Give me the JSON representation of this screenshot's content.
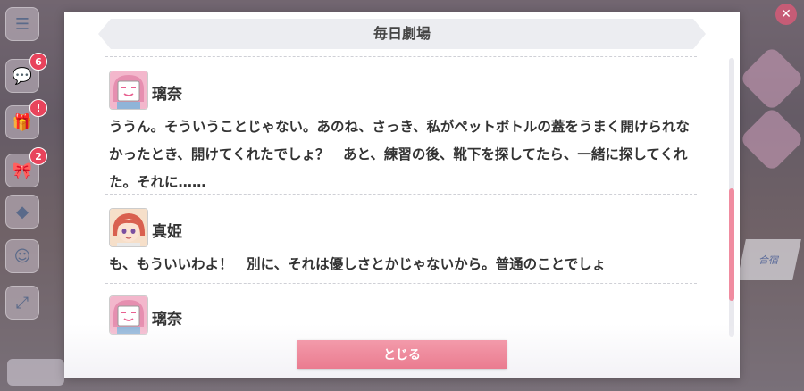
{
  "dialog": {
    "title": "毎日劇場",
    "close_label": "とじる"
  },
  "entries": [
    {
      "speaker": "璃奈",
      "avatar": "rina-board-avatar",
      "text": "ううん。そういうことじゃない。あのね、さっき、私がペットボトルの蓋をうまく開けられなかったとき、開けてくれたでしょ？　あと、練習の後、靴下を探してたら、一緒に探してくれた。それに……"
    },
    {
      "speaker": "真姫",
      "avatar": "maki-avatar",
      "text": "も、もういいわよ！　別に、それは優しさとかじゃないから。普通のことでしょ"
    },
    {
      "speaker": "璃奈",
      "avatar": "rina-board-avatar",
      "text": ""
    }
  ],
  "background": {
    "left_badges": [
      "6",
      "!",
      "!",
      "2"
    ],
    "right_label": "合宿"
  },
  "colors": {
    "accent": "#ea7c90",
    "badge": "#e8445c"
  }
}
